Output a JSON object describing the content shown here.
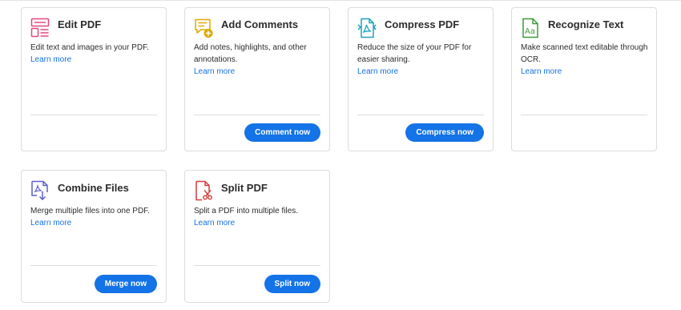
{
  "tools": [
    {
      "title": "Edit PDF",
      "description": "Edit text and images in your PDF.",
      "learn_more": "Learn more",
      "button": "",
      "icon": "edit-pdf-icon",
      "icon_color": "#e2487a"
    },
    {
      "title": "Add Comments",
      "description": "Add notes, highlights, and other annotations.",
      "learn_more": "Learn more",
      "button": "Comment now",
      "icon": "add-comment-icon",
      "icon_color": "#e0a800"
    },
    {
      "title": "Compress PDF",
      "description": "Reduce the size of your PDF for easier sharing.",
      "learn_more": "Learn more",
      "button": "Compress now",
      "icon": "compress-pdf-icon",
      "icon_color": "#1aa3b8"
    },
    {
      "title": "Recognize Text",
      "description": "Make scanned text editable through OCR.",
      "learn_more": "Learn more",
      "button": "",
      "icon": "recognize-text-icon",
      "icon_color": "#3d9a3d"
    },
    {
      "title": "Combine Files",
      "description": "Merge multiple files into one PDF.",
      "learn_more": "Learn more",
      "button": "Merge now",
      "icon": "combine-files-icon",
      "icon_color": "#5a5fd0"
    },
    {
      "title": "Split PDF",
      "description": "Split a PDF into multiple files.",
      "learn_more": "Learn more",
      "button": "Split now",
      "icon": "split-pdf-icon",
      "icon_color": "#d93a3a"
    }
  ],
  "colors": {
    "accent": "#1473e6",
    "border": "#dcdcdc"
  }
}
